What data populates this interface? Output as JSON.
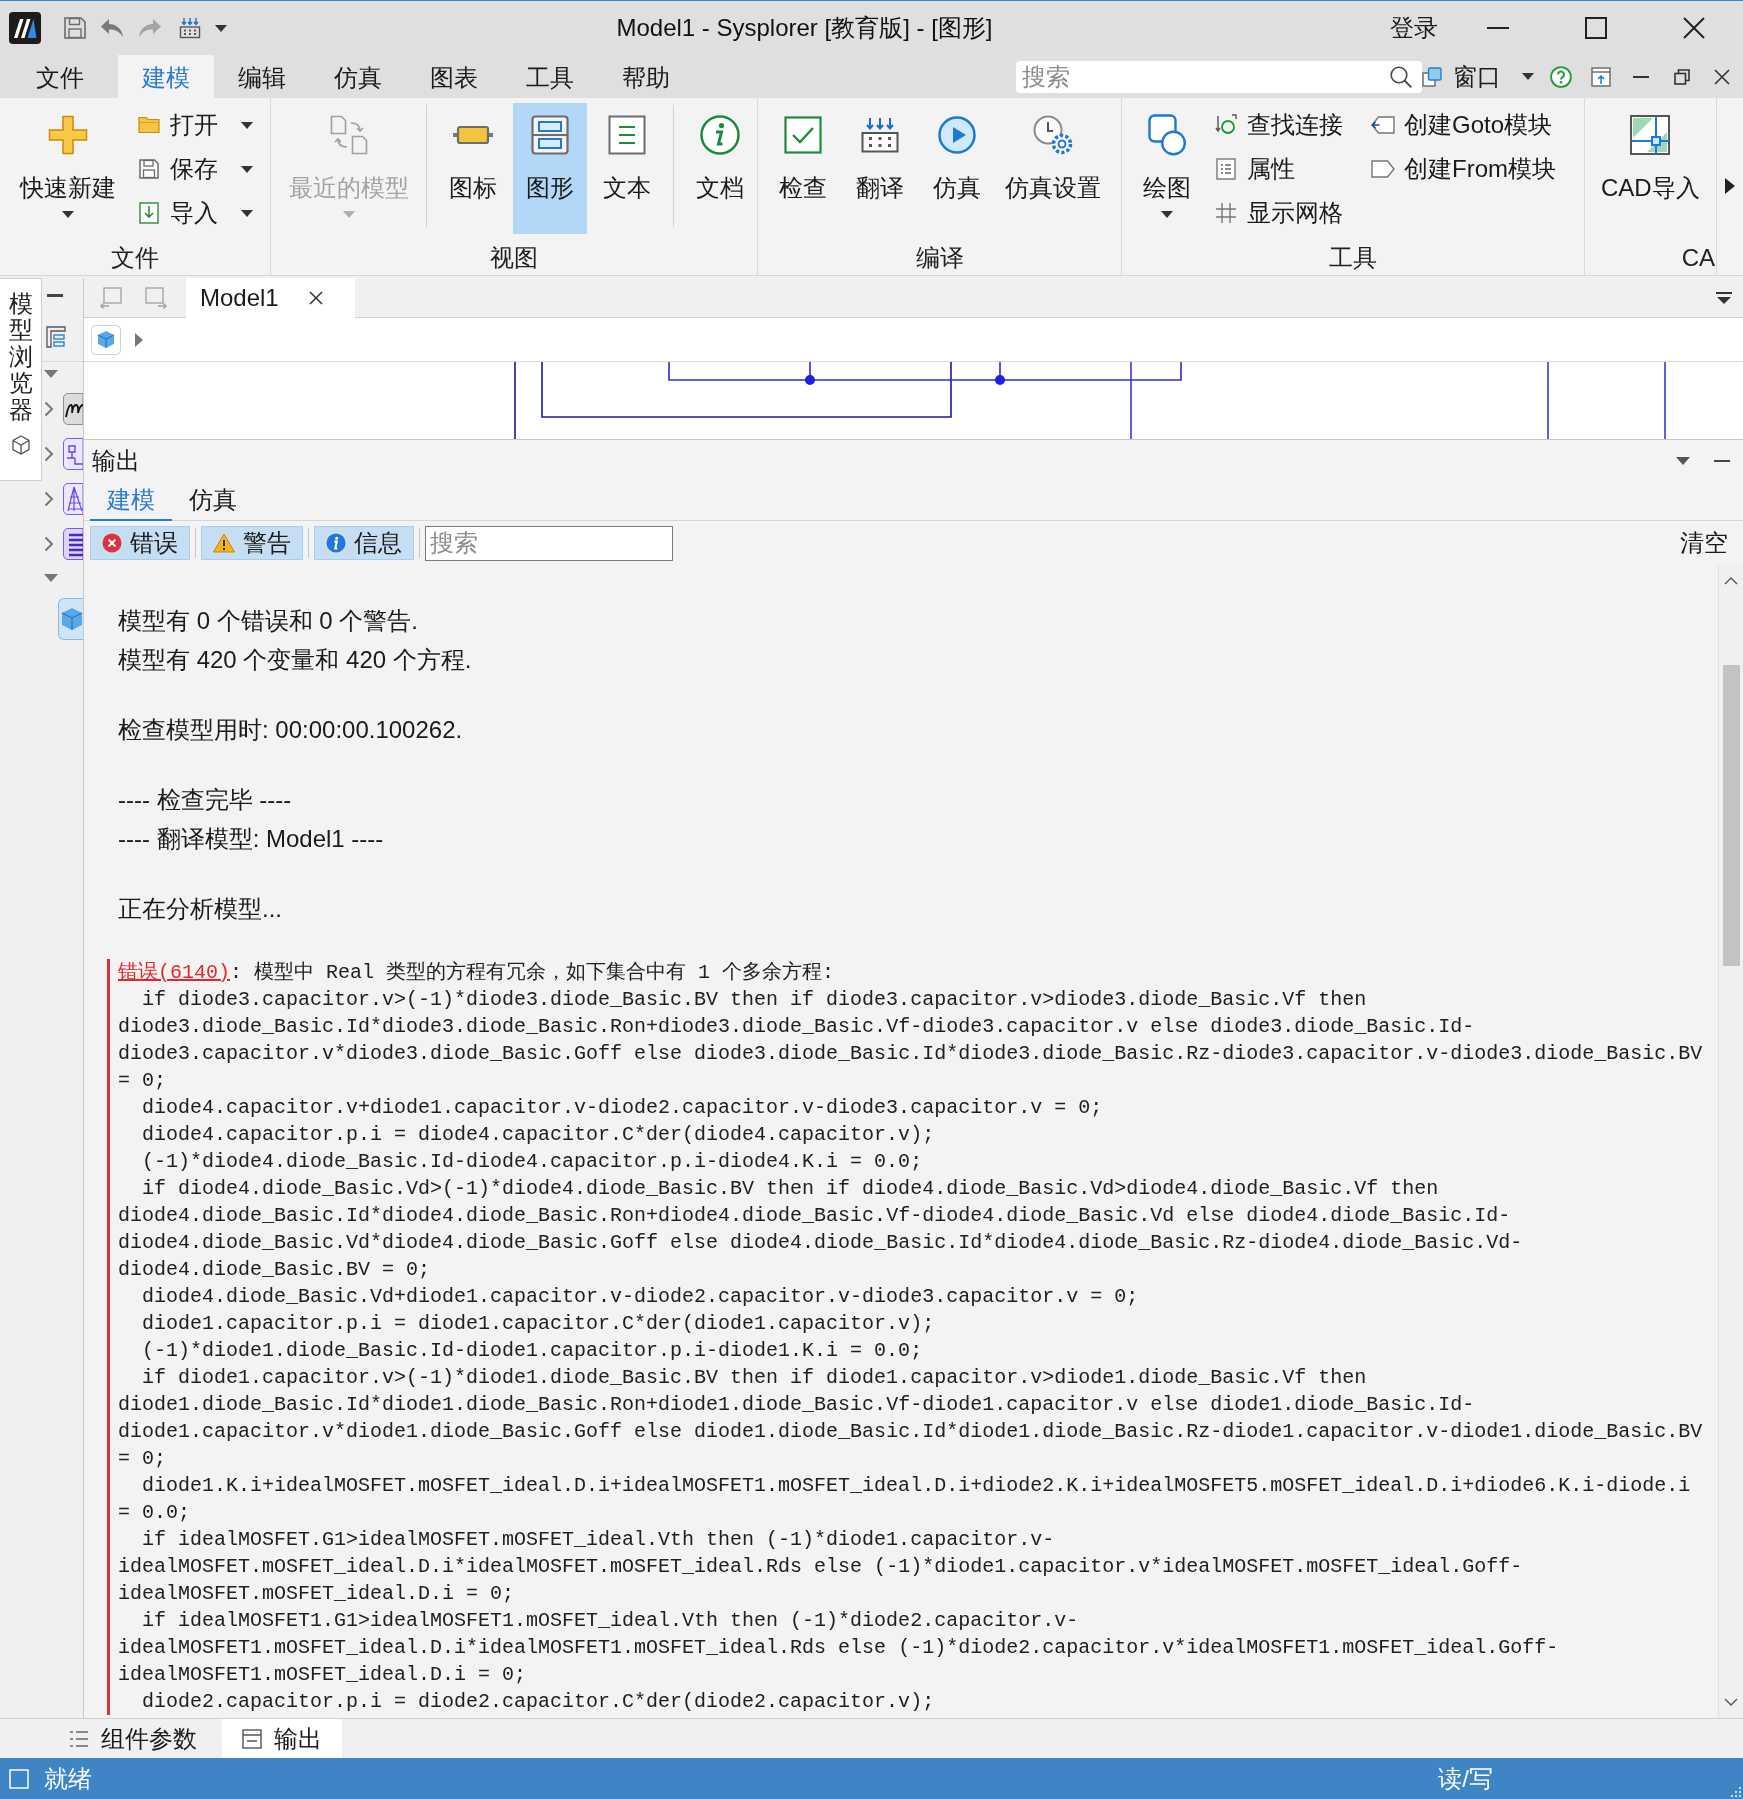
{
  "window": {
    "title": "Model1 - Sysplorer [教育版] - [图形]",
    "login": "登录"
  },
  "menu": {
    "tabs": [
      {
        "label": "文件",
        "selected": false
      },
      {
        "label": "建模",
        "selected": true
      },
      {
        "label": "编辑",
        "selected": false
      },
      {
        "label": "仿真",
        "selected": false
      },
      {
        "label": "图表",
        "selected": false
      },
      {
        "label": "工具",
        "selected": false
      },
      {
        "label": "帮助",
        "selected": false
      }
    ],
    "search": {
      "placeholder": "搜索"
    },
    "window_menu": "窗口"
  },
  "ribbon": {
    "groups": [
      {
        "label": "文件",
        "items": [
          {
            "kind": "large",
            "label": "快速新建",
            "dropdown": true
          },
          {
            "kind": "small",
            "label": "打开",
            "dropdown": true
          },
          {
            "kind": "small",
            "label": "保存",
            "dropdown": true
          },
          {
            "kind": "small",
            "label": "导入",
            "dropdown": true
          }
        ]
      },
      {
        "label": "视图",
        "items": [
          {
            "kind": "large",
            "label": "最近的模型",
            "dropdown": true,
            "disabled": true,
            "selected": false
          },
          {
            "kind": "separator"
          },
          {
            "kind": "large",
            "label": "图标",
            "dropdown": false,
            "disabled": false,
            "selected": false
          },
          {
            "kind": "large",
            "label": "图形",
            "dropdown": false,
            "disabled": false,
            "selected": true
          },
          {
            "kind": "large",
            "label": "文本",
            "dropdown": false,
            "disabled": false,
            "selected": false
          },
          {
            "kind": "separator"
          },
          {
            "kind": "large",
            "label": "文档",
            "dropdown": false,
            "disabled": false,
            "selected": false
          }
        ]
      },
      {
        "label": "编译",
        "items": [
          {
            "kind": "large",
            "label": "检查",
            "dropdown": false
          },
          {
            "kind": "large",
            "label": "翻译",
            "dropdown": false
          },
          {
            "kind": "large",
            "label": "仿真",
            "dropdown": false
          },
          {
            "kind": "large",
            "label": "仿真设置",
            "dropdown": false
          }
        ]
      },
      {
        "label": "工具",
        "items": [
          {
            "kind": "large",
            "label": "绘图",
            "dropdown": true
          },
          {
            "kind": "small",
            "label": "查找连接",
            "dropdown": false
          },
          {
            "kind": "small",
            "label": "属性",
            "dropdown": false
          },
          {
            "kind": "small",
            "label": "显示网格",
            "dropdown": false
          },
          {
            "kind": "small",
            "label": "创建Goto模块",
            "dropdown": false
          },
          {
            "kind": "small",
            "label": "创建From模块",
            "dropdown": false
          }
        ]
      },
      {
        "label": "CA",
        "items": [
          {
            "kind": "large",
            "label": "CAD导入",
            "dropdown": false
          }
        ]
      }
    ]
  },
  "model_browser": {
    "title": "模型浏览器",
    "sections": [
      {
        "expanded": true,
        "items": [
          {
            "expanded": false
          },
          {
            "expanded": false
          },
          {
            "expanded": false
          },
          {
            "expanded": false
          }
        ]
      },
      {
        "expanded": true,
        "items": [
          {
            "selected": true
          }
        ]
      }
    ]
  },
  "document": {
    "tabs": [
      {
        "label": "Model1",
        "selected": true
      }
    ]
  },
  "output": {
    "title": "输出",
    "tabs": [
      {
        "label": "建模",
        "selected": true
      },
      {
        "label": "仿真",
        "selected": false
      }
    ],
    "filters": [
      {
        "label": "错误",
        "on": true
      },
      {
        "label": "警告",
        "on": true
      },
      {
        "label": "信息",
        "on": true
      }
    ],
    "search": {
      "placeholder": "搜索"
    },
    "clear": "清空",
    "log": [
      {
        "kind": "text",
        "lines": [
          "模型有 0 个错误和 0 个警告.",
          "模型有 420 个变量和 420 个方程."
        ]
      },
      {
        "kind": "text",
        "lines": [
          "检查模型用时: 00:00:00.100262."
        ]
      },
      {
        "kind": "text",
        "lines": [
          "---- 检查完毕 ----",
          "---- 翻译模型: Model1 ----"
        ]
      },
      {
        "kind": "text",
        "lines": [
          "正在分析模型..."
        ]
      },
      {
        "kind": "error",
        "code": "错误(6140)",
        "message": ": 模型中 Real 类型的方程有冗余，如下集合中有 1 个多余方程:",
        "equations": [
          "if diode3.capacitor.v>(-1)*diode3.diode_Basic.BV then if diode3.capacitor.v>diode3.diode_Basic.Vf then diode3.diode_Basic.Id*diode3.diode_Basic.Ron+diode3.diode_Basic.Vf-diode3.capacitor.v else diode3.diode_Basic.Id-diode3.capacitor.v*diode3.diode_Basic.Goff else diode3.diode_Basic.Id*diode3.diode_Basic.Rz-diode3.capacitor.v-diode3.diode_Basic.BV = 0;",
          "diode4.capacitor.v+diode1.capacitor.v-diode2.capacitor.v-diode3.capacitor.v = 0;",
          "diode4.capacitor.p.i = diode4.capacitor.C*der(diode4.capacitor.v);",
          "(-1)*diode4.diode_Basic.Id-diode4.capacitor.p.i-diode4.K.i = 0.0;",
          "if diode4.diode_Basic.Vd>(-1)*diode4.diode_Basic.BV then if diode4.diode_Basic.Vd>diode4.diode_Basic.Vf then diode4.diode_Basic.Id*diode4.diode_Basic.Ron+diode4.diode_Basic.Vf-diode4.diode_Basic.Vd else diode4.diode_Basic.Id-diode4.diode_Basic.Vd*diode4.diode_Basic.Goff else diode4.diode_Basic.Id*diode4.diode_Basic.Rz-diode4.diode_Basic.Vd-diode4.diode_Basic.BV = 0;",
          "diode4.diode_Basic.Vd+diode1.capacitor.v-diode2.capacitor.v-diode3.capacitor.v = 0;",
          "diode1.capacitor.p.i = diode1.capacitor.C*der(diode1.capacitor.v);",
          "(-1)*diode1.diode_Basic.Id-diode1.capacitor.p.i-diode1.K.i = 0.0;",
          "if diode1.capacitor.v>(-1)*diode1.diode_Basic.BV then if diode1.capacitor.v>diode1.diode_Basic.Vf then diode1.diode_Basic.Id*diode1.diode_Basic.Ron+diode1.diode_Basic.Vf-diode1.capacitor.v else diode1.diode_Basic.Id-diode1.capacitor.v*diode1.diode_Basic.Goff else diode1.diode_Basic.Id*diode1.diode_Basic.Rz-diode1.capacitor.v-diode1.diode_Basic.BV = 0;",
          "diode1.K.i+idealMOSFET.mOSFET_ideal.D.i+idealMOSFET1.mOSFET_ideal.D.i+diode2.K.i+idealMOSFET5.mOSFET_ideal.D.i+diode6.K.i-diode.i = 0.0;",
          "if idealMOSFET.G1>idealMOSFET.mOSFET_ideal.Vth then (-1)*diode1.capacitor.v-idealMOSFET.mOSFET_ideal.D.i*idealMOSFET.mOSFET_ideal.Rds else (-1)*diode1.capacitor.v*idealMOSFET.mOSFET_ideal.Goff-idealMOSFET.mOSFET_ideal.D.i = 0;",
          "if idealMOSFET1.G1>idealMOSFET1.mOSFET_ideal.Vth then (-1)*diode2.capacitor.v-idealMOSFET1.mOSFET_ideal.D.i*idealMOSFET1.mOSFET_ideal.Rds else (-1)*diode2.capacitor.v*idealMOSFET1.mOSFET_ideal.Goff-idealMOSFET1.mOSFET_ideal.D.i = 0;",
          "diode2.capacitor.p.i = diode2.capacitor.C*der(diode2.capacitor.v);"
        ]
      }
    ]
  },
  "bottom_tabs": [
    {
      "label": "组件参数",
      "selected": false
    },
    {
      "label": "输出",
      "selected": true
    }
  ],
  "status_bar": {
    "left": "就绪",
    "right": "读/写"
  }
}
